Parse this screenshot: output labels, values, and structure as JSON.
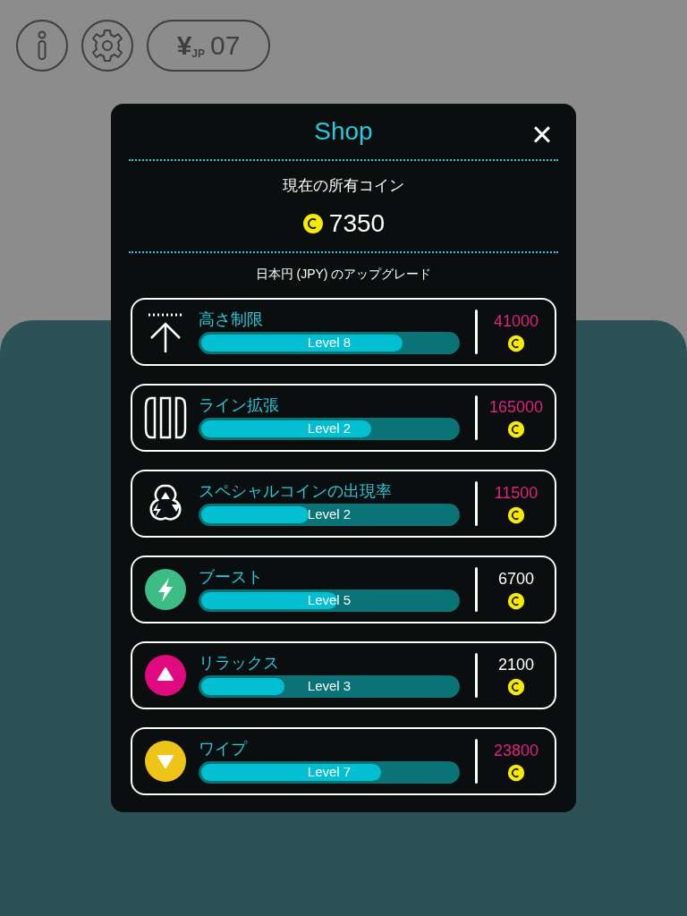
{
  "top_bar": {
    "currency_symbol": "¥",
    "currency_code": "JP",
    "currency_value": "07"
  },
  "shop": {
    "title": "Shop",
    "close": "×",
    "coins_label": "現在の所有コイン",
    "coins": "7350",
    "section_title": "日本円 (JPY) のアップグレード",
    "upgrades": [
      {
        "kind": "height",
        "name": "高さ制限",
        "level": 0.79,
        "level_text": "Level 8",
        "price": "41000",
        "affordable": false
      },
      {
        "kind": "lines",
        "name": "ライン拡張",
        "level": 0.67,
        "level_text": "Level 2",
        "price": "165000",
        "affordable": false
      },
      {
        "kind": "special",
        "name": "スペシャルコインの出現率",
        "level": 0.43,
        "level_text": "Level 2",
        "price": "11500",
        "affordable": false
      },
      {
        "kind": "boost",
        "name": "ブースト",
        "level": 0.54,
        "level_text": "Level 5",
        "price": "6700",
        "affordable": true,
        "color": "#3dbd85"
      },
      {
        "kind": "relax",
        "name": "リラックス",
        "level": 0.34,
        "level_text": "Level 3",
        "price": "2100",
        "affordable": true,
        "color": "#e0097e"
      },
      {
        "kind": "wipe",
        "name": "ワイプ",
        "level": 0.71,
        "level_text": "Level 7",
        "price": "23800",
        "affordable": false,
        "color": "#efc419"
      }
    ]
  }
}
